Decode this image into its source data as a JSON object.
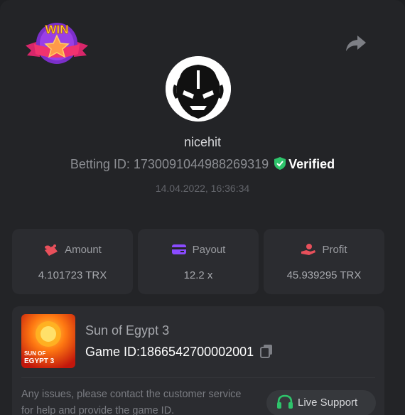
{
  "badge": {
    "text": "WIN"
  },
  "user": {
    "name": "nicehit",
    "betting_id_label": "Betting ID: 1730091044988269319",
    "verified_label": "Verified",
    "timestamp": "14.04.2022, 16:36:34"
  },
  "stats": [
    {
      "label": "Amount",
      "value": "4.101723 TRX",
      "icon": "coin-stack-icon",
      "icon_color": "#e8505b"
    },
    {
      "label": "Payout",
      "value": "12.2 x",
      "icon": "card-icon",
      "icon_color": "#8a4bff"
    },
    {
      "label": "Profit",
      "value": "45.939295 TRX",
      "icon": "hand-coin-icon",
      "icon_color": "#e8505b"
    }
  ],
  "game": {
    "name": "Sun of Egypt 3",
    "id_label": "Game ID:1866542700002001",
    "thumb_text_1": "SUN OF",
    "thumb_text_2": "EGYPT 3"
  },
  "support": {
    "note": "Any issues, please contact the customer service for help and provide the game ID.",
    "button_label": "Live Support"
  },
  "colors": {
    "background": "#232427",
    "card": "#2b2c30",
    "verified_green": "#2ec46b",
    "support_green": "#2ec46b"
  }
}
